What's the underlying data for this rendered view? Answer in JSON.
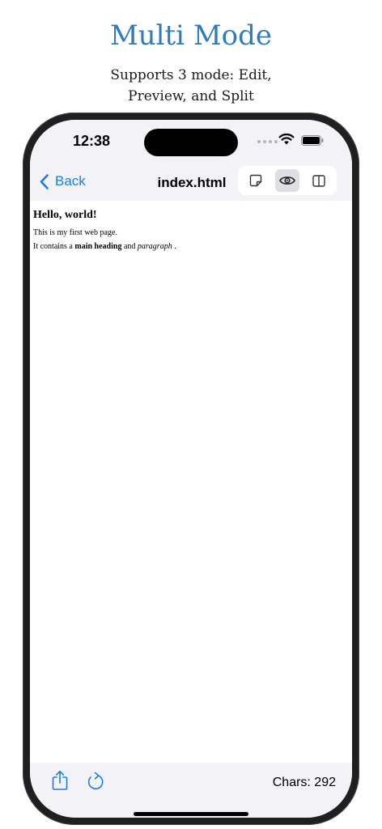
{
  "promo": {
    "title": "Multi Mode",
    "subtitle_line1": "Supports 3 mode: Edit,",
    "subtitle_line2": "Preview, and Split"
  },
  "status_bar": {
    "time": "12:38",
    "icons": [
      "signal-dots-icon",
      "wifi-icon",
      "battery-icon"
    ]
  },
  "nav": {
    "back_label": "Back",
    "title": "index.html",
    "modes": [
      {
        "name": "edit",
        "icon": "note-icon",
        "active": false
      },
      {
        "name": "preview",
        "icon": "eye-icon",
        "active": true
      },
      {
        "name": "split",
        "icon": "split-view-icon",
        "active": false
      }
    ]
  },
  "preview": {
    "heading": "Hello, world!",
    "p1": "This is my first web page.",
    "p2_prefix": "It contains a ",
    "p2_bold": "main heading",
    "p2_mid": " and ",
    "p2_italic": "paragraph",
    "p2_suffix": " ."
  },
  "bottom_bar": {
    "char_count": "Chars: 292",
    "icons": [
      "share-icon",
      "refresh-icon"
    ]
  },
  "colors": {
    "accent": "#1a7de0",
    "promo_title": "#2f7bbd",
    "bar_background": "#f2f2f7"
  }
}
